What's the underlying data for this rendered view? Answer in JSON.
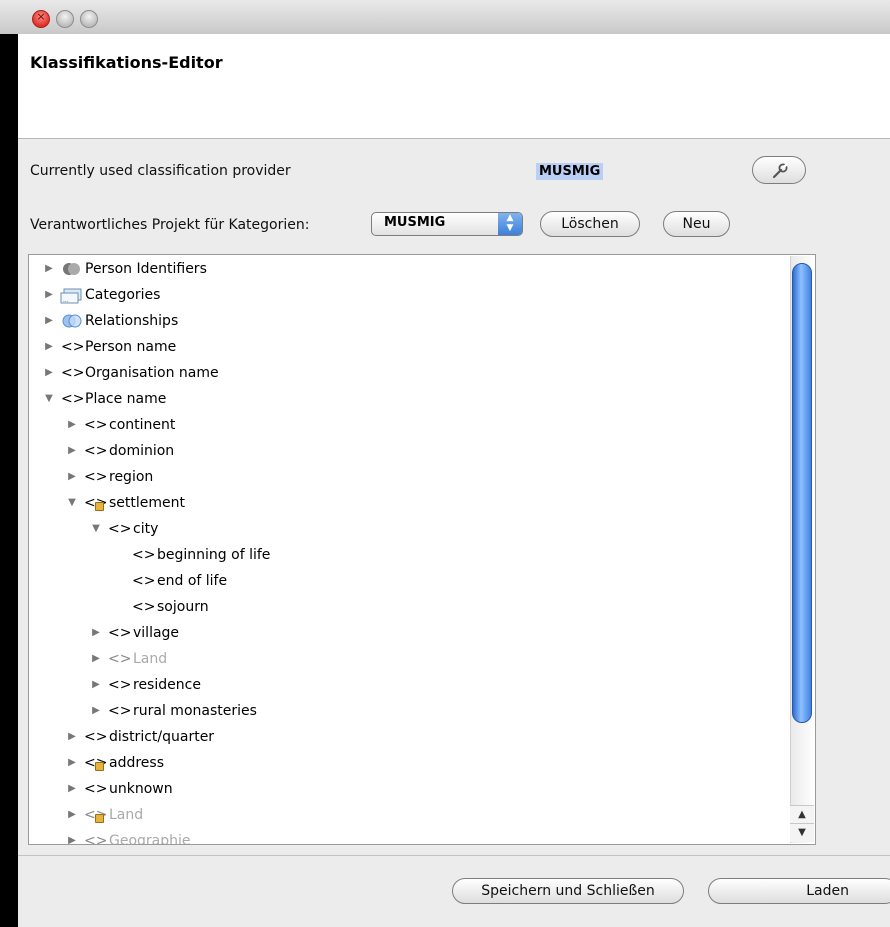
{
  "window": {
    "title": "Klassifikations-Editor"
  },
  "provider": {
    "label": "Currently used classification provider",
    "value": "MUSMIG"
  },
  "project": {
    "label": "Verantwortliches Projekt für Kategorien:",
    "selected": "MUSMIG",
    "delete_label": "Löschen",
    "new_label": "Neu"
  },
  "tree": {
    "rows": [
      {
        "label": "Person Identifiers"
      },
      {
        "label": "Categories"
      },
      {
        "label": "Relationships"
      },
      {
        "label": "Person name"
      },
      {
        "label": "Organisation name"
      },
      {
        "label": "Place name"
      },
      {
        "label": "continent"
      },
      {
        "label": "dominion"
      },
      {
        "label": "region"
      },
      {
        "label": "settlement"
      },
      {
        "label": "city"
      },
      {
        "label": "beginning of life"
      },
      {
        "label": "end of life"
      },
      {
        "label": "sojourn"
      },
      {
        "label": "village"
      },
      {
        "label": "Land"
      },
      {
        "label": "residence"
      },
      {
        "label": "rural monasteries"
      },
      {
        "label": "district/quarter"
      },
      {
        "label": "address"
      },
      {
        "label": "unknown"
      },
      {
        "label": "Land"
      },
      {
        "label": "Geographie"
      }
    ]
  },
  "footer": {
    "save_close_label": "Speichern und Schließen",
    "load_label": "Laden"
  }
}
